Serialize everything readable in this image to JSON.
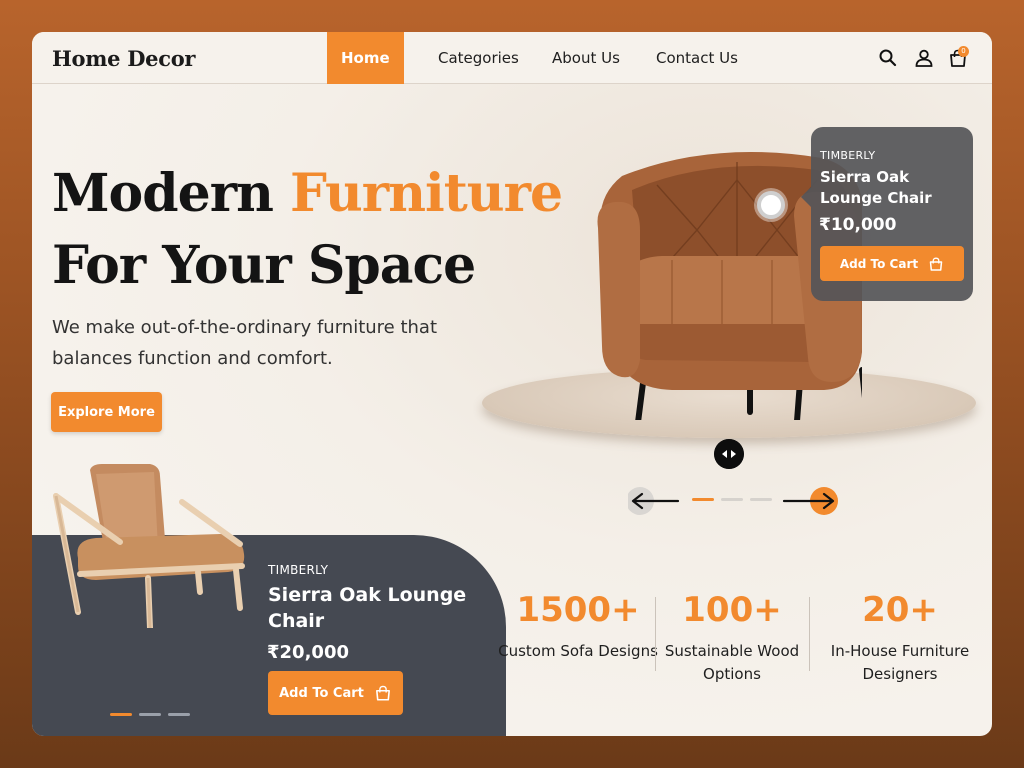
{
  "nav": {
    "logo": "Home Decor",
    "items": [
      "Home",
      "Categories",
      "About Us",
      "Contact Us"
    ],
    "icons": [
      "search-icon",
      "user-icon",
      "shopping-bag-icon"
    ],
    "cart_count": "0"
  },
  "hero": {
    "title_line1_a": "Modern ",
    "title_line1_b": "Furniture",
    "title_line2": "For Your Space",
    "subtitle": "We make out-of-the-ordinary furniture that balances function and comfort.",
    "cta": "Explore More"
  },
  "featured": {
    "brand": "TIMBERLY",
    "name": "Sierra Oak Lounge Chair",
    "currency": "₹",
    "price": "10,000",
    "add_to_cart": "Add To Cart"
  },
  "card": {
    "brand": "TIMBERLY",
    "name": "Sierra Oak Lounge Chair",
    "currency": "₹",
    "price": "20,000",
    "add_to_cart": "Add To Cart"
  },
  "stats": [
    {
      "value": "1500+",
      "label": "Custom Sofa Designs"
    },
    {
      "value": "100+",
      "label": "Sustainable Wood Options"
    },
    {
      "value": "20+",
      "label": "In-House Furniture Designers"
    }
  ],
  "colors": {
    "accent": "#f28a2e",
    "dark_card": "#454952",
    "text": "#141414"
  }
}
